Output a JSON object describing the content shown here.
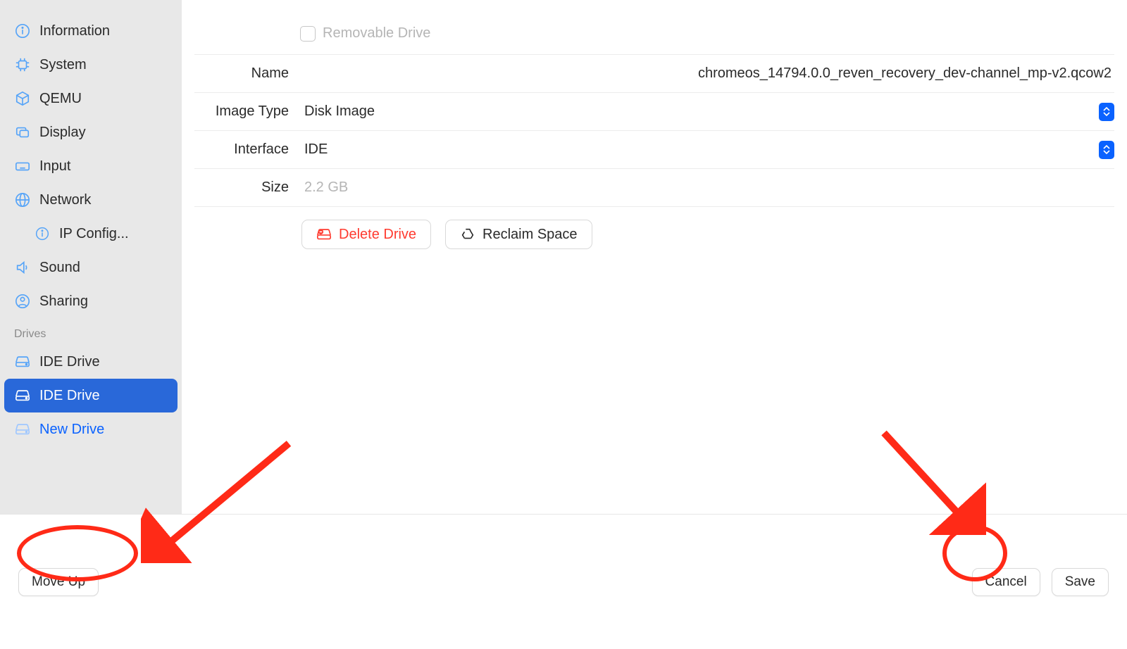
{
  "sidebar": {
    "main_items": [
      {
        "label": "Information",
        "icon": "info"
      },
      {
        "label": "System",
        "icon": "chip"
      },
      {
        "label": "QEMU",
        "icon": "cube"
      },
      {
        "label": "Display",
        "icon": "display"
      },
      {
        "label": "Input",
        "icon": "keyboard"
      },
      {
        "label": "Network",
        "icon": "globe"
      },
      {
        "label": "IP Config...",
        "icon": "info",
        "indented": true
      },
      {
        "label": "Sound",
        "icon": "speaker"
      },
      {
        "label": "Sharing",
        "icon": "person"
      }
    ],
    "drives_header": "Drives",
    "drives": [
      {
        "label": "IDE Drive",
        "icon": "drive"
      },
      {
        "label": "IDE Drive",
        "icon": "drive",
        "selected": true
      },
      {
        "label": "New Drive",
        "icon": "drive",
        "new": true
      }
    ]
  },
  "form": {
    "removable_label": "Removable Drive",
    "name_label": "Name",
    "name_value": "chromeos_14794.0.0_reven_recovery_dev-channel_mp-v2.qcow2",
    "image_type_label": "Image Type",
    "image_type_value": "Disk Image",
    "interface_label": "Interface",
    "interface_value": "IDE",
    "size_label": "Size",
    "size_value": "2.2 GB",
    "delete_label": "Delete Drive",
    "reclaim_label": "Reclaim Space"
  },
  "footer": {
    "move_up": "Move Up",
    "cancel": "Cancel",
    "save": "Save"
  }
}
